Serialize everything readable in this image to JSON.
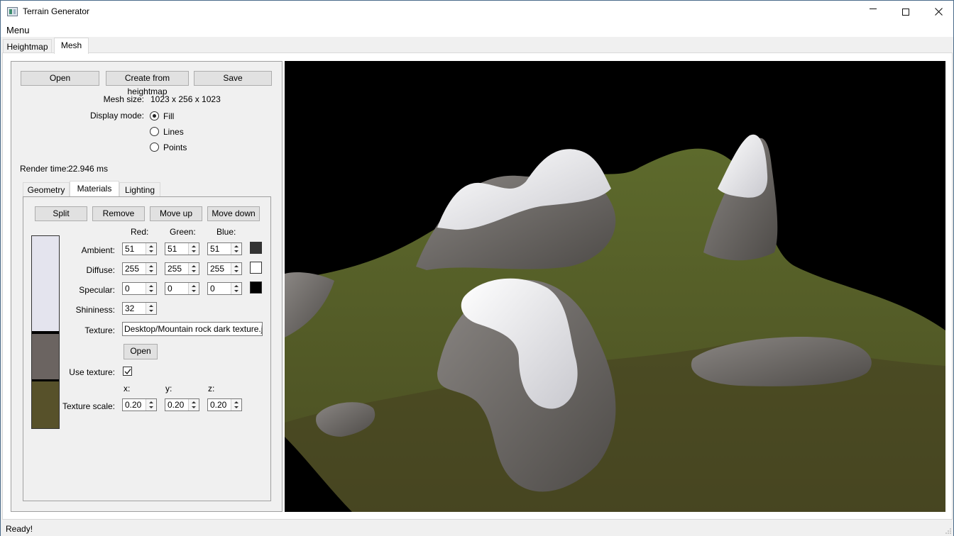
{
  "window": {
    "title": "Terrain Generator",
    "controls": {
      "minimize": "minimize-icon",
      "maximize": "maximize-icon",
      "close": "close-icon"
    }
  },
  "menubar": {
    "menu_label": "Menu"
  },
  "top_tabs": [
    {
      "label": "Heightmap",
      "active": false
    },
    {
      "label": "Mesh",
      "active": true
    }
  ],
  "mesh_panel": {
    "buttons": {
      "open": "Open",
      "create_from_heightmap": "Create from heightmap",
      "save": "Save"
    },
    "mesh_size_label": "Mesh size:",
    "mesh_size_value": "1023 x 256 x 1023",
    "display_mode_label": "Display mode:",
    "display_modes": [
      {
        "label": "Fill",
        "checked": true
      },
      {
        "label": "Lines",
        "checked": false
      },
      {
        "label": "Points",
        "checked": false
      }
    ],
    "render_time_label": "Render time:",
    "render_time_value": "22.946 ms"
  },
  "inner_tabs": [
    {
      "label": "Geometry",
      "active": false
    },
    {
      "label": "Materials",
      "active": true
    },
    {
      "label": "Lighting",
      "active": false
    }
  ],
  "materials": {
    "buttons": {
      "split": "Split",
      "remove": "Remove",
      "move_up": "Move up",
      "move_down": "Move down"
    },
    "gradient_segments": [
      {
        "color": "#e4e4ee"
      },
      {
        "color": "#6b6461"
      },
      {
        "color": "#57512a"
      }
    ],
    "column_headers": {
      "red": "Red:",
      "green": "Green:",
      "blue": "Blue:"
    },
    "rows": {
      "ambient": {
        "label": "Ambient:",
        "red": "51",
        "green": "51",
        "blue": "51",
        "swatch": "#333333"
      },
      "diffuse": {
        "label": "Diffuse:",
        "red": "255",
        "green": "255",
        "blue": "255",
        "swatch": "#ffffff"
      },
      "specular": {
        "label": "Specular:",
        "red": "0",
        "green": "0",
        "blue": "0",
        "swatch": "#000000"
      }
    },
    "shininess_label": "Shininess:",
    "shininess_value": "32",
    "texture_label": "Texture:",
    "texture_value": "Desktop/Mountain rock dark texture.jpg",
    "texture_open": "Open",
    "use_texture_label": "Use texture:",
    "use_texture_checked": true,
    "scale_headers": {
      "x": "x:",
      "y": "y:",
      "z": "z:"
    },
    "texture_scale_label": "Texture scale:",
    "texture_scale": {
      "x": "0.20",
      "y": "0.20",
      "z": "0.20"
    }
  },
  "viewport": {
    "background": "#000000",
    "grass_color": "#4f5a26",
    "rock_color": "#6e6a66",
    "snow_color": "#f2f2f4"
  },
  "statusbar": {
    "text": "Ready!"
  }
}
